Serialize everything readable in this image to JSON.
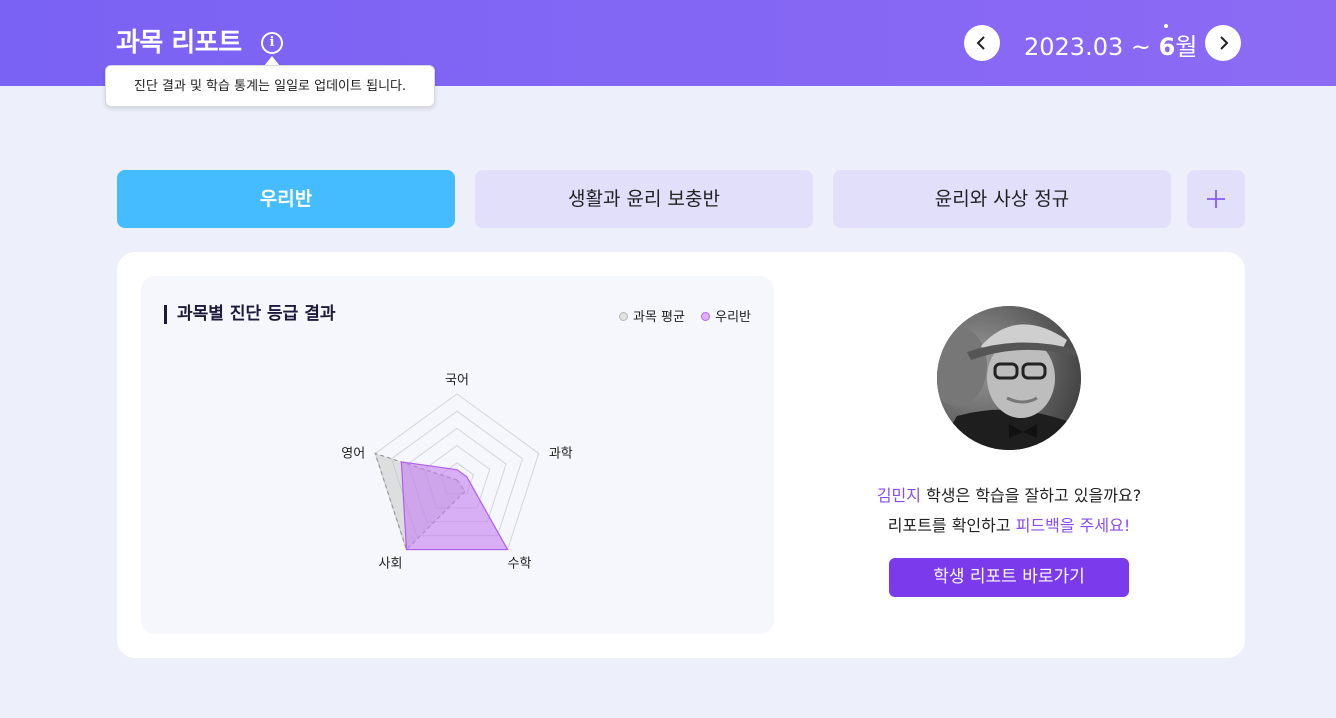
{
  "header": {
    "title": "과목 리포트",
    "info_icon": "info-icon",
    "tooltip": "진단 결과 및 학습 통계는 일일로 업데이트 됩니다.",
    "date_prefix": "2023.03 ~ ",
    "date_month": "6",
    "date_suffix": "월",
    "prev_icon": "chevron-left-icon",
    "next_icon": "chevron-right-icon"
  },
  "tabs": [
    {
      "label": "우리반",
      "active": true
    },
    {
      "label": "생활과 윤리 보충반",
      "active": false
    },
    {
      "label": "윤리와 사상 정규",
      "active": false
    }
  ],
  "add_tab_icon": "plus-icon",
  "chart_section": {
    "title": "과목별 진단 등급 결과",
    "legend": [
      {
        "name": "과목 평균",
        "color": "#cfcfcf"
      },
      {
        "name": "우리반",
        "color": "#d9a6f5"
      }
    ]
  },
  "chart_data": {
    "type": "radar",
    "categories": [
      "국어",
      "과학",
      "수학",
      "사회",
      "영어"
    ],
    "rlim": [
      0,
      5
    ],
    "series": [
      {
        "name": "과목 평균",
        "values": [
          0,
          0,
          0.8,
          5,
          5
        ],
        "color": "#c8c8c8"
      },
      {
        "name": "우리반",
        "values": [
          0.6,
          0.6,
          5,
          5,
          3.4
        ],
        "color": "#c47ef0"
      }
    ]
  },
  "student_panel": {
    "student_name": "김민지",
    "line1_rest": " 학생은 학습을 잘하고 있을까요?",
    "line2_prefix": "리포트를 확인하고 ",
    "line2_highlight": "피드백을 주세요!",
    "button_label": "학생 리포트 바로가기"
  },
  "colors": {
    "header": "#7a62f4",
    "active_tab": "#45bcff",
    "inactive_tab": "#e1dffa",
    "button": "#7c3aed",
    "highlight": "#8a4df0"
  }
}
